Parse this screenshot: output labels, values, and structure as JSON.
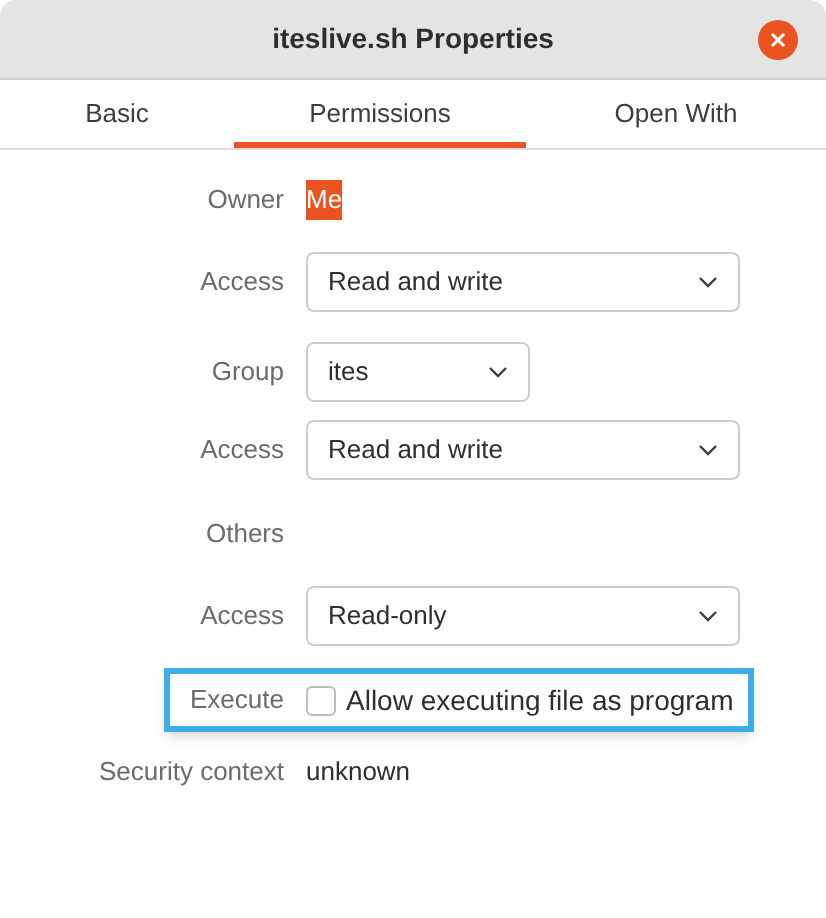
{
  "window": {
    "title": "iteslive.sh Properties"
  },
  "tabs": [
    {
      "label": "Basic",
      "selected": false
    },
    {
      "label": "Permissions",
      "selected": true
    },
    {
      "label": "Open With",
      "selected": false
    }
  ],
  "rows": [
    {
      "kind": "text",
      "label": "Owner",
      "value": "Me",
      "text_selected": true
    },
    {
      "kind": "dropdown",
      "label": "Access",
      "value": "Read and write",
      "wide": true
    },
    {
      "kind": "dropdown",
      "label": "Group",
      "value": "ites",
      "wide": false
    },
    {
      "kind": "dropdown",
      "label": "Access",
      "value": "Read and write",
      "wide": true
    },
    {
      "kind": "heading",
      "label": "Others"
    },
    {
      "kind": "dropdown",
      "label": "Access",
      "value": "Read-only",
      "wide": true
    },
    {
      "kind": "checkbox",
      "label": "Execute",
      "value": "Allow executing file as program",
      "checked": false,
      "highlighted": true
    },
    {
      "kind": "text",
      "label": "Security context",
      "value": "unknown",
      "text_selected": false
    }
  ]
}
